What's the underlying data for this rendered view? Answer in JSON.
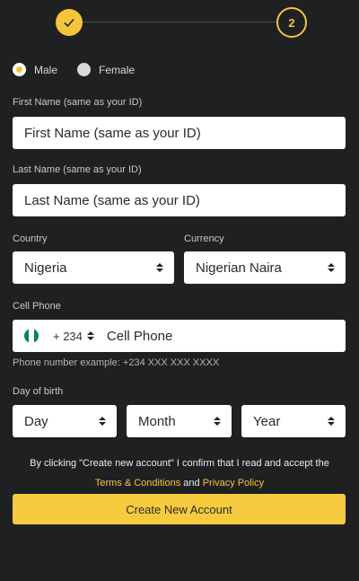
{
  "stepper": {
    "step_two_label": "2"
  },
  "gender": {
    "male": "Male",
    "female": "Female",
    "selected": "Male"
  },
  "first_name": {
    "label": "First Name (same as your ID)",
    "placeholder": "First Name  (same as your ID)"
  },
  "last_name": {
    "label": "Last Name (same as your ID)",
    "placeholder": "Last Name (same as your ID)"
  },
  "country": {
    "label": "Country",
    "value": "Nigeria"
  },
  "currency": {
    "label": "Currency",
    "value": "Nigerian Naira"
  },
  "cell_phone": {
    "label": "Cell Phone",
    "dial_code": "+ 234",
    "placeholder": "Cell Phone",
    "hint": "Phone number example: +234 XXX XXX XXXX",
    "flag_colors": [
      "#008751",
      "#ffffff",
      "#008751"
    ]
  },
  "birth": {
    "label": "Day of birth",
    "day": "Day",
    "month": "Month",
    "year": "Year"
  },
  "consent": {
    "text": "By clicking \"Create new account\" I confirm that I read and accept the",
    "terms": "Terms & Conditions",
    "and": "and",
    "privacy": "Privacy Policy"
  },
  "submit_label": "Create New Account",
  "colors": {
    "accent": "#f5c538",
    "background": "#1f2022"
  }
}
